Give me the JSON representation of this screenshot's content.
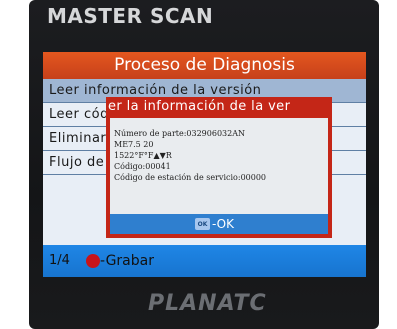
{
  "device": {
    "brand": "MASTER SCAN",
    "footer_brand": "PLANATC"
  },
  "screen": {
    "title": "Proceso de Diagnosis",
    "menu": [
      {
        "label": "Leer información de la versión",
        "selected": true
      },
      {
        "label": "Leer códigos"
      },
      {
        "label": "Eliminar"
      },
      {
        "label": "Flujo de datos"
      }
    ],
    "status": {
      "page": "1/4",
      "record_label": "-Grabar"
    }
  },
  "dialog": {
    "title": "er la información de la ver",
    "lines": [
      "Número de parte:032906032AN",
      "ME7.5 20",
      "1522°F°F▲▼R",
      "Código:00041",
      "Código de estación de servicio:00000"
    ],
    "ok_icon": "OK",
    "ok_label": "-OK"
  },
  "colors": {
    "title_bar": "#c6401a",
    "status_bar": "#1f86e6",
    "dialog_frame": "#c42617",
    "selected_row": "#9fb6d3"
  }
}
